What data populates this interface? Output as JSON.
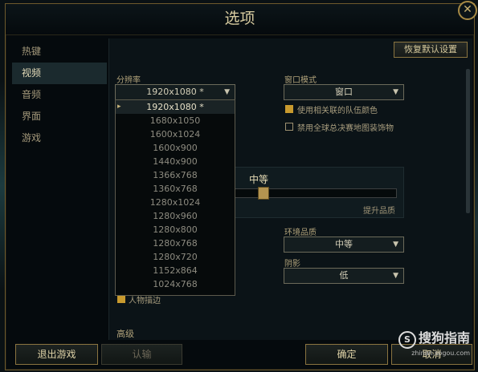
{
  "dialog": {
    "title": "选项",
    "close_glyph": "✕"
  },
  "sidebar": {
    "items": [
      "热键",
      "视频",
      "音频",
      "界面",
      "游戏"
    ],
    "active_index": 1
  },
  "restore_button": "恢复默认设置",
  "resolution": {
    "label": "分辨率",
    "value": "1920x1080 *",
    "options": [
      "1920x1080 *",
      "1680x1050",
      "1600x1024",
      "1600x900",
      "1440x900",
      "1366x768",
      "1360x768",
      "1280x1024",
      "1280x960",
      "1280x800",
      "1280x768",
      "1280x720",
      "1152x864",
      "1024x768"
    ]
  },
  "window_mode": {
    "label": "窗口模式",
    "value": "窗口"
  },
  "checkboxes": [
    {
      "label": "使用相关联的队伍颜色",
      "checked": true
    },
    {
      "label": "禁用全球总决赛地图装饰物",
      "checked": false
    }
  ],
  "graphics_quality": {
    "label": "中等",
    "level": 0.15,
    "improve_link": "提升品质"
  },
  "environment_quality": {
    "label": "环境品质",
    "value": "中等"
  },
  "shadows": {
    "label": "阴影",
    "value": "低"
  },
  "partial_checkbox_label": "人物描边",
  "partial_section_label": "高级",
  "footer": {
    "exit_game": "退出游戏",
    "confirm_left": "认输",
    "ok": "确定",
    "cancel": "取消"
  },
  "watermark": {
    "logo": "S",
    "text": "搜狗指南",
    "url": "zhinan.sogou.com"
  },
  "colors": {
    "accent_gold": "#c89a2e",
    "border_gold": "#8a7440"
  }
}
